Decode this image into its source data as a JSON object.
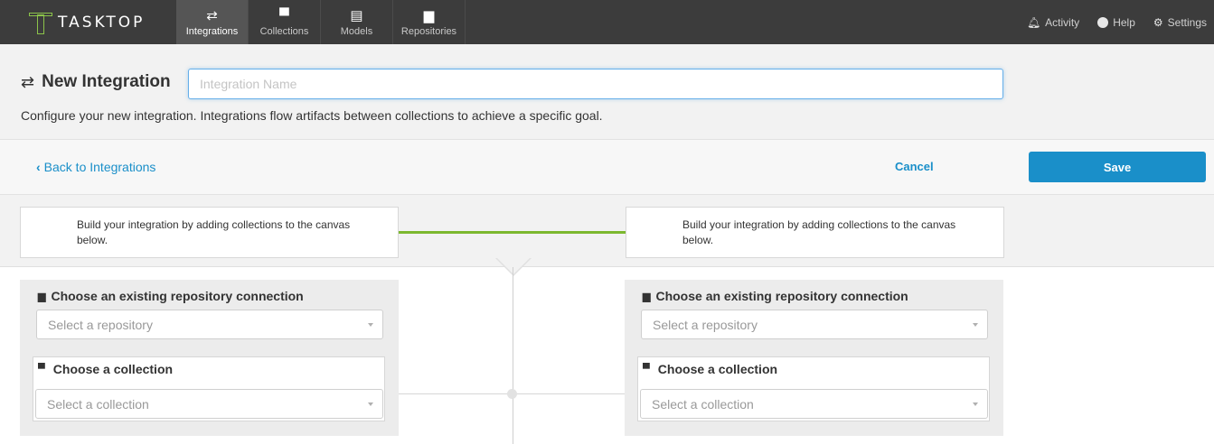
{
  "nav": {
    "logo_text": "TASKTOP",
    "tabs": [
      {
        "label": "Integrations",
        "icon": "arrows-exchange-icon",
        "active": true
      },
      {
        "label": "Collections",
        "icon": "archive-box-icon",
        "active": false
      },
      {
        "label": "Models",
        "icon": "document-icon",
        "active": false
      },
      {
        "label": "Repositories",
        "icon": "database-icon",
        "active": false
      }
    ],
    "right": [
      {
        "label": "Activity",
        "icon": "bell-icon"
      },
      {
        "label": "Help",
        "icon": "question-circle-icon"
      },
      {
        "label": "Settings",
        "icon": "gear-icon"
      }
    ]
  },
  "header": {
    "title": "New Integration",
    "title_icon": "arrows-exchange-icon",
    "name_placeholder": "Integration Name",
    "subtitle": "Configure your new integration. Integrations flow artifacts between collections to achieve a specific goal."
  },
  "actions": {
    "back_label": "Back to Integrations",
    "cancel_label": "Cancel",
    "save_label": "Save"
  },
  "canvas": {
    "hint_left": "Build your integration by adding collections to the canvas below.",
    "hint_right": "Build your integration by adding collections to the canvas below.",
    "left_panel": {
      "repo_title": "Choose an existing repository connection",
      "repo_placeholder": "Select a repository",
      "collection_title": "Choose a collection",
      "collection_placeholder": "Select a collection"
    },
    "right_panel": {
      "repo_title": "Choose an existing repository connection",
      "repo_placeholder": "Select a repository",
      "collection_title": "Choose a collection",
      "collection_placeholder": "Select a collection"
    }
  },
  "colors": {
    "topnav_bg": "#3c3c3c",
    "accent_blue": "#1a8fc9",
    "connector_green": "#7cb82f",
    "logo_green": "#8bc34a"
  }
}
